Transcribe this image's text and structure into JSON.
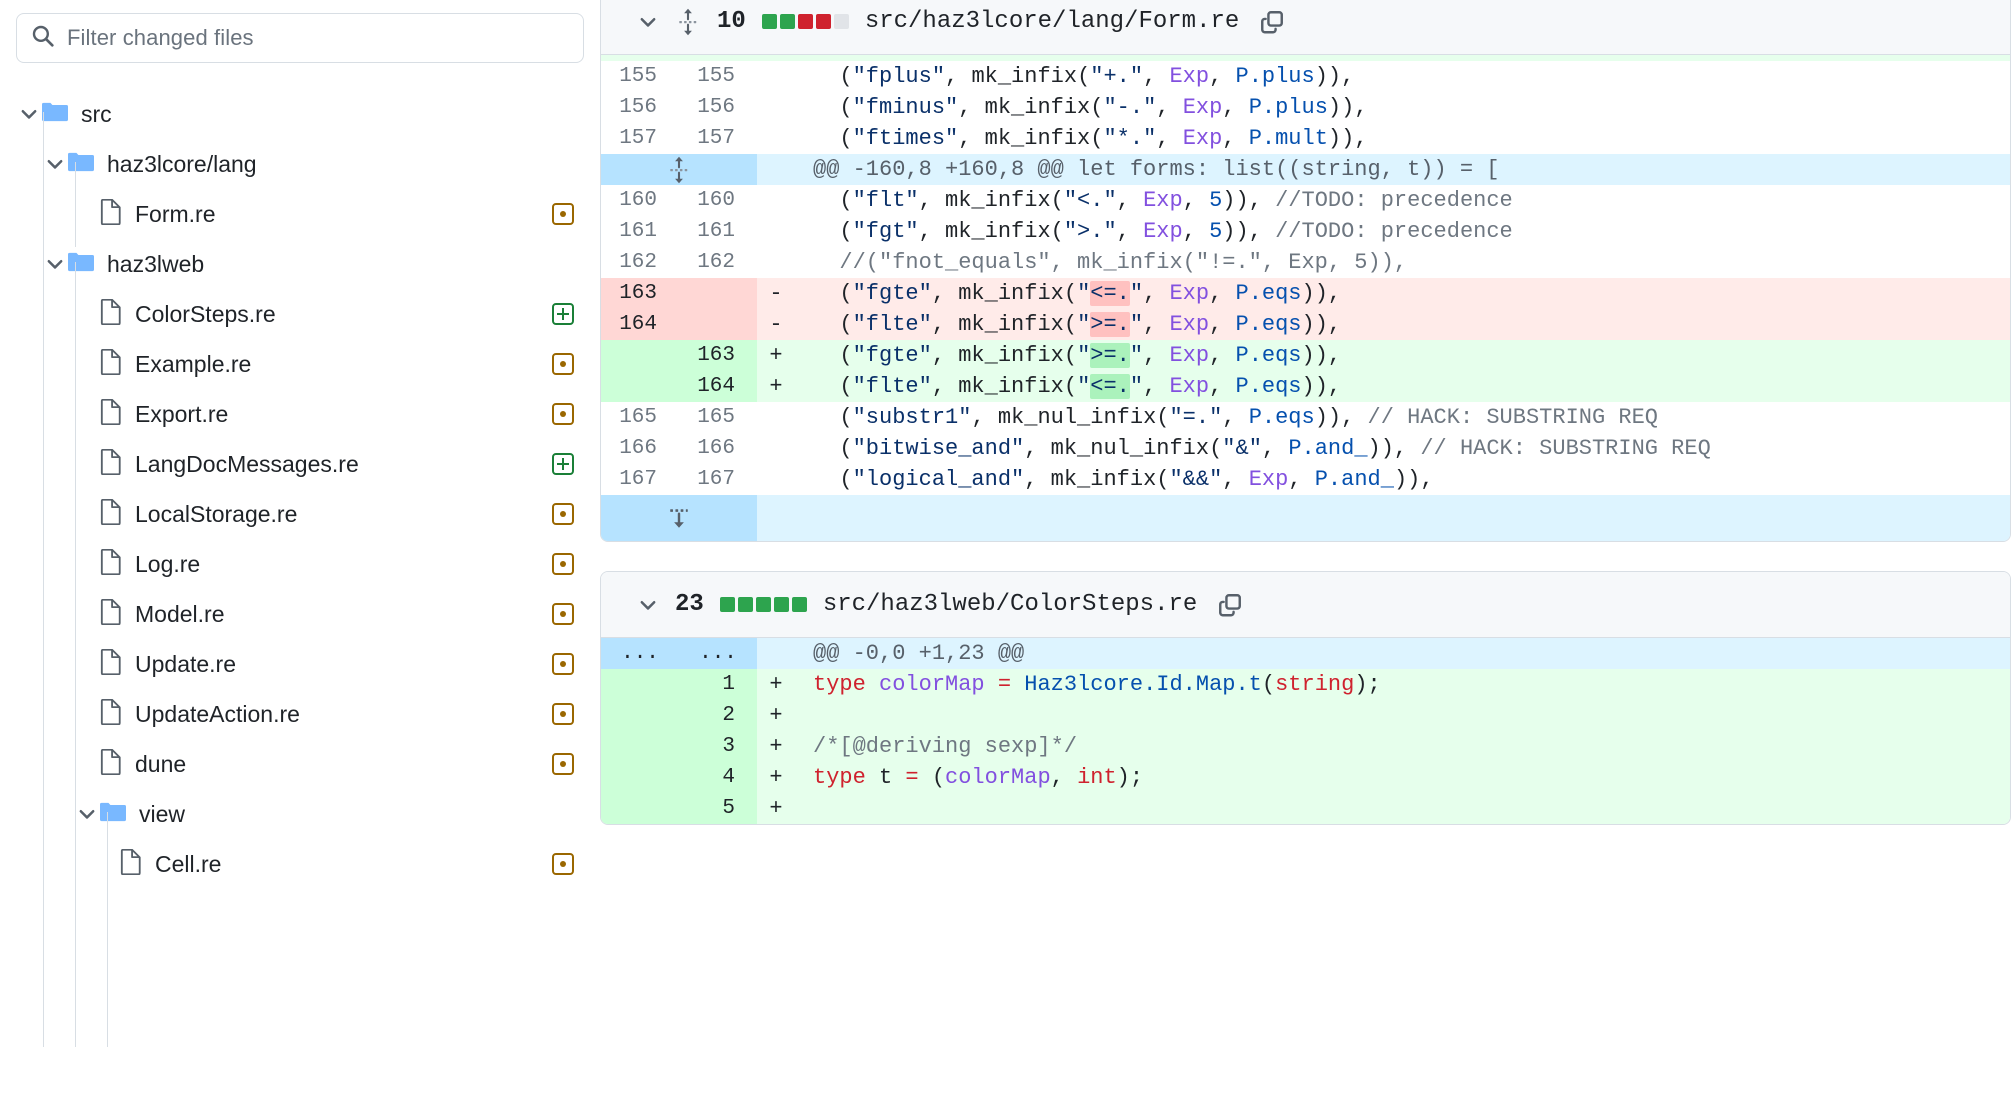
{
  "sidebar": {
    "filter": {
      "placeholder": "Filter changed files",
      "value": "",
      "icon": "search-icon"
    },
    "tree": [
      {
        "kind": "folder",
        "label": "src",
        "depth": 0,
        "expanded": true,
        "chevron": "chevron-down-icon",
        "status": ""
      },
      {
        "kind": "folder",
        "label": "haz3lcore/lang",
        "depth": 1,
        "expanded": true,
        "chevron": "chevron-down-icon",
        "status": ""
      },
      {
        "kind": "file",
        "label": "Form.re",
        "depth": 2,
        "status": "modified"
      },
      {
        "kind": "folder",
        "label": "haz3lweb",
        "depth": 1,
        "expanded": true,
        "chevron": "chevron-down-icon",
        "status": ""
      },
      {
        "kind": "file",
        "label": "ColorSteps.re",
        "depth": 2,
        "status": "added"
      },
      {
        "kind": "file",
        "label": "Example.re",
        "depth": 2,
        "status": "modified"
      },
      {
        "kind": "file",
        "label": "Export.re",
        "depth": 2,
        "status": "modified"
      },
      {
        "kind": "file",
        "label": "LangDocMessages.re",
        "depth": 2,
        "status": "added"
      },
      {
        "kind": "file",
        "label": "LocalStorage.re",
        "depth": 2,
        "status": "modified"
      },
      {
        "kind": "file",
        "label": "Log.re",
        "depth": 2,
        "status": "modified"
      },
      {
        "kind": "file",
        "label": "Model.re",
        "depth": 2,
        "status": "modified"
      },
      {
        "kind": "file",
        "label": "Update.re",
        "depth": 2,
        "status": "modified"
      },
      {
        "kind": "file",
        "label": "UpdateAction.re",
        "depth": 2,
        "status": "modified"
      },
      {
        "kind": "file",
        "label": "dune",
        "depth": 2,
        "status": "modified"
      },
      {
        "kind": "folder",
        "label": "view",
        "depth": 2,
        "expanded": true,
        "chevron": "chevron-down-icon",
        "status": ""
      },
      {
        "kind": "file",
        "label": "Cell.re",
        "depth": 3,
        "status": "modified"
      }
    ]
  },
  "files": [
    {
      "collapse_icon": "chevron-down-icon",
      "drag_icon": "unfold-icon",
      "change_count": "10",
      "blocks": [
        "g",
        "g",
        "r",
        "r",
        "n"
      ],
      "path": "src/haz3lcore/lang/Form.re",
      "copy_icon": "copy-icon",
      "rows": [
        {
          "type": "ctx",
          "old": "155",
          "new": "155",
          "sign": "",
          "code": "  (\"fplus\", mk_infix(\"+.\", Exp, P.plus)),"
        },
        {
          "type": "ctx",
          "old": "156",
          "new": "156",
          "sign": "",
          "code": "  (\"fminus\", mk_infix(\"-.\", Exp, P.plus)),"
        },
        {
          "type": "ctx",
          "old": "157",
          "new": "157",
          "sign": "",
          "code": "  (\"ftimes\", mk_infix(\"*.\", Exp, P.mult)),"
        },
        {
          "type": "hunk",
          "old": "",
          "new": "",
          "sign": "",
          "code": "@@ -160,8 +160,8 @@ let forms: list((string, t)) = [",
          "icon": "unfold-icon"
        },
        {
          "type": "ctx",
          "old": "160",
          "new": "160",
          "sign": "",
          "code": "  (\"flt\", mk_infix(\"<.\", Exp, 5)), //TODO: precedence"
        },
        {
          "type": "ctx",
          "old": "161",
          "new": "161",
          "sign": "",
          "code": "  (\"fgt\", mk_infix(\">.\", Exp, 5)), //TODO: precedence"
        },
        {
          "type": "ctx",
          "old": "162",
          "new": "162",
          "sign": "",
          "code": "  //(\"fnot_equals\", mk_infix(\"!=.\", Exp, 5)),"
        },
        {
          "type": "del",
          "old": "163",
          "new": "",
          "sign": "-",
          "code": "  (\"fgte\", mk_infix(\"<=.\", Exp, P.eqs)),"
        },
        {
          "type": "del",
          "old": "164",
          "new": "",
          "sign": "-",
          "code": "  (\"flte\", mk_infix(\">=.\", Exp, P.eqs)),"
        },
        {
          "type": "add",
          "old": "",
          "new": "163",
          "sign": "+",
          "code": "  (\"fgte\", mk_infix(\">=.\", Exp, P.eqs)),"
        },
        {
          "type": "add",
          "old": "",
          "new": "164",
          "sign": "+",
          "code": "  (\"flte\", mk_infix(\"<=.\", Exp, P.eqs)),"
        },
        {
          "type": "ctx",
          "old": "165",
          "new": "165",
          "sign": "",
          "code": "  (\"substr1\", mk_nul_infix(\"=.\", P.eqs)), // HACK: SUBSTRING REQ"
        },
        {
          "type": "ctx",
          "old": "166",
          "new": "166",
          "sign": "",
          "code": "  (\"bitwise_and\", mk_nul_infix(\"&\", P.and_)), // HACK: SUBSTRING REQ"
        },
        {
          "type": "ctx",
          "old": "167",
          "new": "167",
          "sign": "",
          "code": "  (\"logical_and\", mk_infix(\"&&\", Exp, P.and_)),"
        },
        {
          "type": "expander",
          "old": "",
          "new": "",
          "sign": "",
          "code": "",
          "icon": "expand-down-icon"
        }
      ]
    },
    {
      "collapse_icon": "chevron-down-icon",
      "drag_icon": "",
      "change_count": "23",
      "blocks": [
        "g",
        "g",
        "g",
        "g",
        "g"
      ],
      "path": "src/haz3lweb/ColorSteps.re",
      "copy_icon": "copy-icon",
      "rows": [
        {
          "type": "hunk",
          "old": "...",
          "new": "...",
          "sign": "",
          "code": "@@ -0,0 +1,23 @@"
        },
        {
          "type": "add",
          "old": "",
          "new": "1",
          "sign": "+",
          "code": "type colorMap = Haz3lcore.Id.Map.t(string);"
        },
        {
          "type": "add",
          "old": "",
          "new": "2",
          "sign": "+",
          "code": ""
        },
        {
          "type": "add",
          "old": "",
          "new": "3",
          "sign": "+",
          "code": "/*[@deriving sexp]*/"
        },
        {
          "type": "add",
          "old": "",
          "new": "4",
          "sign": "+",
          "code": "type t = (colorMap, int);"
        },
        {
          "type": "add",
          "old": "",
          "new": "5",
          "sign": "+",
          "code": ""
        }
      ]
    }
  ],
  "colors": {
    "added_bg": "#e6ffec",
    "added_gutter": "#ccffd8",
    "deleted_bg": "#ffebe9",
    "deleted_gutter": "#ffd7d5",
    "hunk_bg": "#ddf4ff",
    "hunk_gutter": "#b6e3ff",
    "word_add": "#abf2bc",
    "word_del": "#ffc1c0",
    "status_modified": "#9a6700",
    "status_added": "#1a7f37",
    "folder_blue": "#79b8ff",
    "header_bg": "#f6f8fa",
    "border": "#d8dee4"
  }
}
